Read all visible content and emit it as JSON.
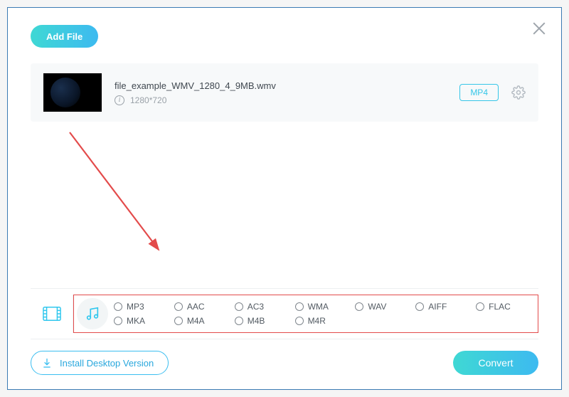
{
  "header": {
    "add_file_label": "Add File"
  },
  "file": {
    "name": "file_example_WMV_1280_4_9MB.wmv",
    "dimensions": "1280*720",
    "output_format": "MP4"
  },
  "format_tabs": {
    "video_tab": "video",
    "audio_tab": "audio"
  },
  "audio_formats_row1": [
    "MP3",
    "AAC",
    "AC3",
    "WMA",
    "WAV",
    "AIFF",
    "FLAC"
  ],
  "audio_formats_row2": [
    "MKA",
    "M4A",
    "M4B",
    "M4R"
  ],
  "footer": {
    "install_label": "Install Desktop Version",
    "convert_label": "Convert"
  }
}
